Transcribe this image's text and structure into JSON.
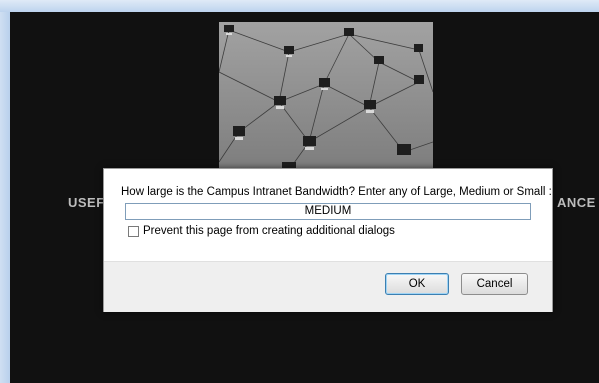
{
  "page": {
    "left_text": "USEF",
    "right_text": "ANCE"
  },
  "dialog": {
    "prompt": "How large is the Campus Intranet Bandwidth? Enter any of Large, Medium or Small :",
    "input_value": "MEDIUM",
    "checkbox_label": "Prevent this page from creating additional dialogs",
    "ok_label": "OK",
    "cancel_label": "Cancel"
  }
}
